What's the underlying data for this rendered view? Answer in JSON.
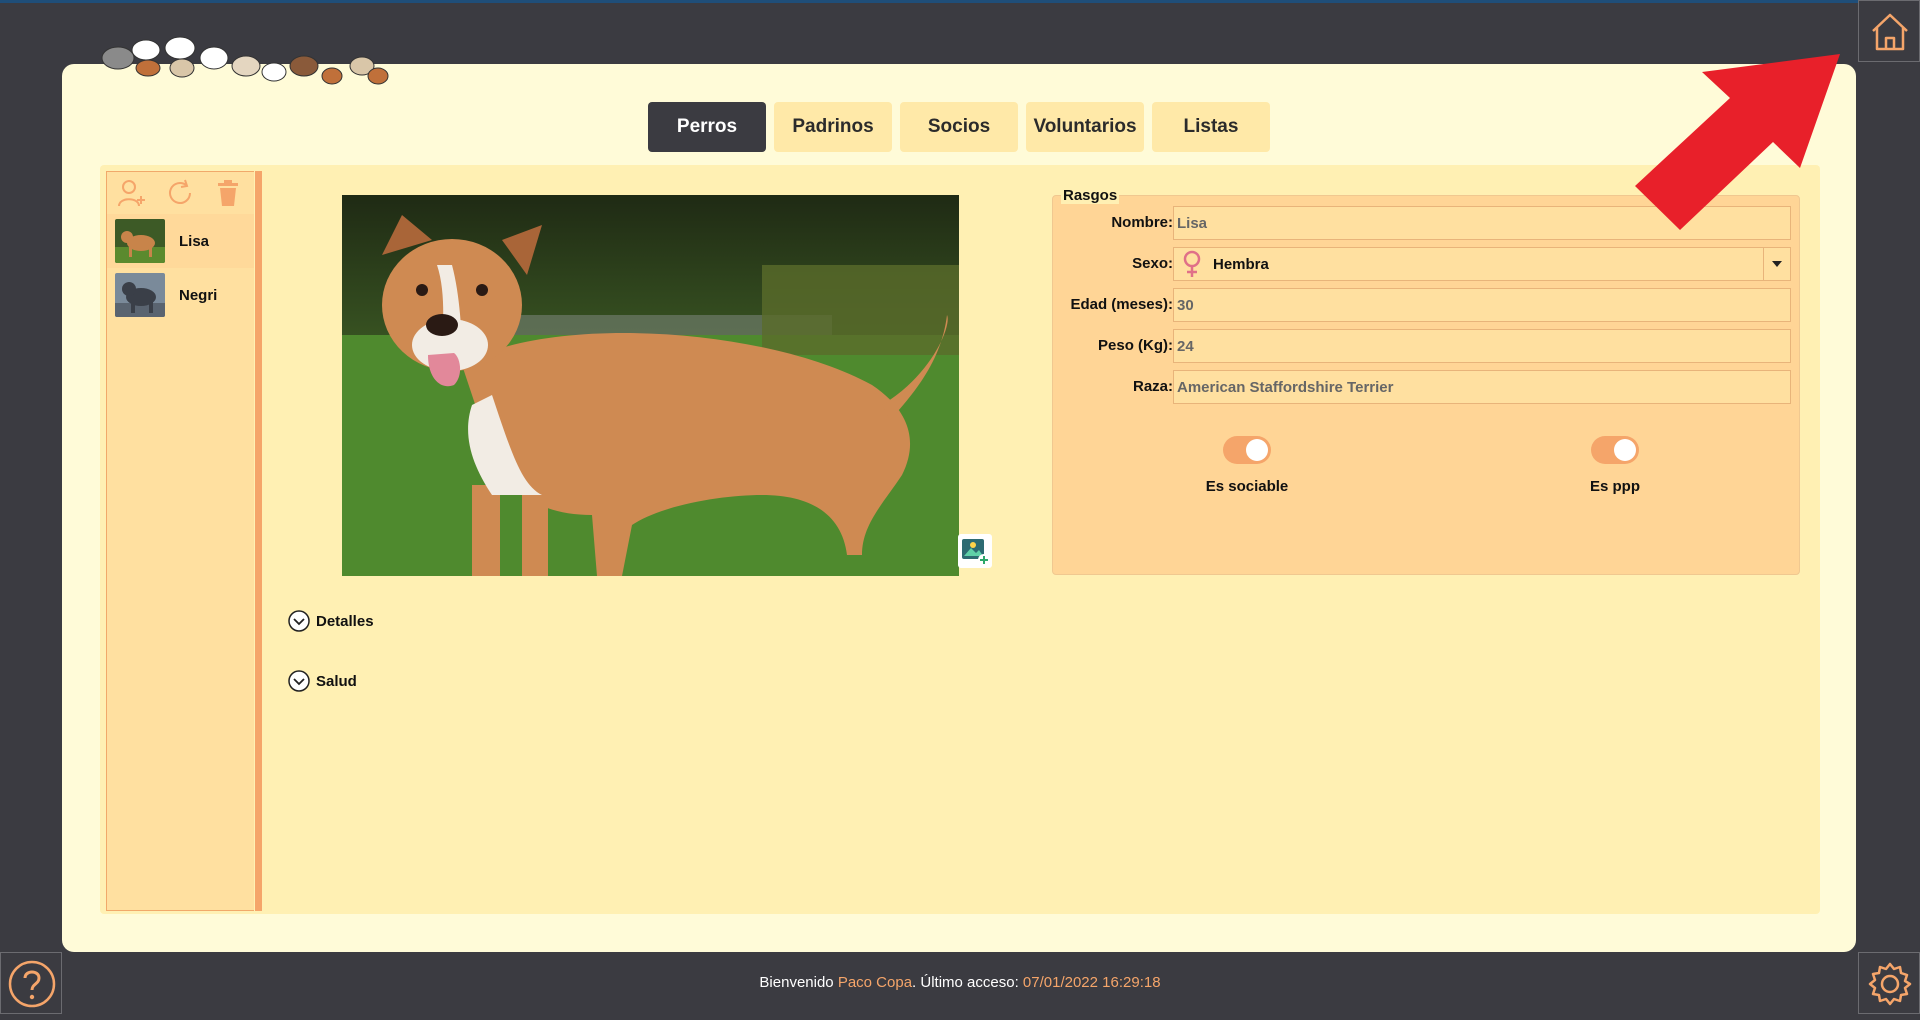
{
  "tabs": [
    "Perros",
    "Padrinos",
    "Socios",
    "Voluntarios",
    "Listas"
  ],
  "active_tab": "Perros",
  "sidebar": {
    "tools": [
      "add-user-icon",
      "refresh-icon",
      "trash-icon"
    ],
    "dogs": [
      {
        "name": "Lisa",
        "selected": true
      },
      {
        "name": "Negri",
        "selected": false
      }
    ]
  },
  "rasgos": {
    "legend": "Rasgos",
    "nombre_label": "Nombre:",
    "nombre_value": "Lisa",
    "sexo_label": "Sexo:",
    "sexo_value": "Hembra",
    "edad_label": "Edad (meses):",
    "edad_value": "30",
    "peso_label": "Peso (Kg):",
    "peso_value": "24",
    "raza_label": "Raza:",
    "raza_value": "American Staffordshire Terrier",
    "sociable_label": "Es sociable",
    "sociable_on": true,
    "ppp_label": "Es ppp",
    "ppp_on": true
  },
  "expanders": {
    "detalles": "Detalles",
    "salud": "Salud"
  },
  "status": {
    "prefix": "Bienvenido ",
    "user": "Paco Copa",
    "middle": ". Último acceso: ",
    "last_access": "07/01/2022 16:29:18"
  },
  "colors": {
    "background": "#3b3b41",
    "card": "#fffbd8",
    "panel": "#fff0b3",
    "accent": "#f5a56a",
    "tab": "#ffe9a8",
    "tab_active": "#3b3b41",
    "annotation_arrow": "#e8202a"
  }
}
